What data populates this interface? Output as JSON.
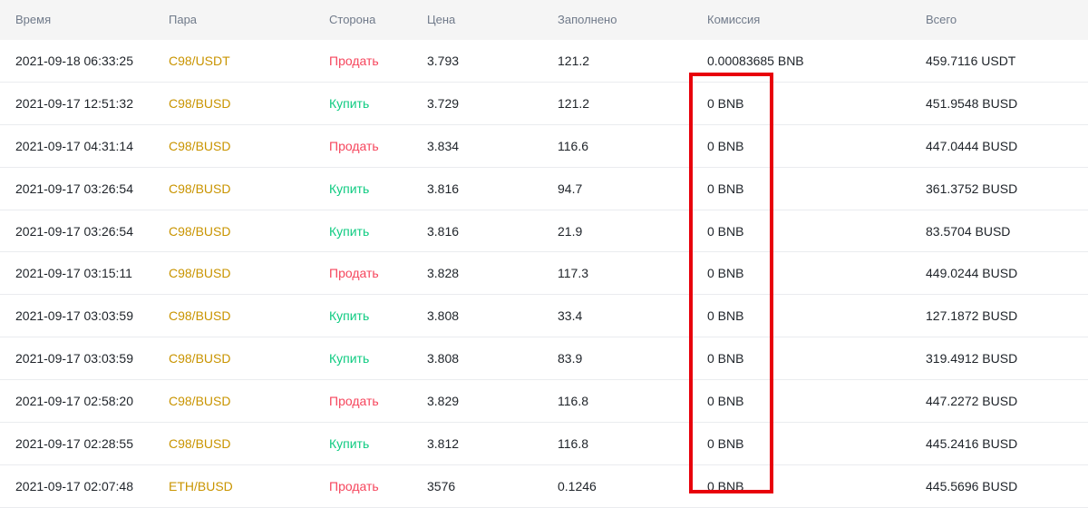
{
  "headers": {
    "time": "Время",
    "pair": "Пара",
    "side": "Сторона",
    "price": "Цена",
    "filled": "Заполнено",
    "fee": "Комиссия",
    "total": "Всего"
  },
  "rows": [
    {
      "time": "2021-09-18 06:33:25",
      "pair": "C98/USDT",
      "side": "Продать",
      "price": "3.793",
      "filled": "121.2",
      "fee": "0.00083685 BNB",
      "total": "459.7116 USDT"
    },
    {
      "time": "2021-09-17 12:51:32",
      "pair": "C98/BUSD",
      "side": "Купить",
      "price": "3.729",
      "filled": "121.2",
      "fee": "0 BNB",
      "total": "451.9548 BUSD"
    },
    {
      "time": "2021-09-17 04:31:14",
      "pair": "C98/BUSD",
      "side": "Продать",
      "price": "3.834",
      "filled": "116.6",
      "fee": "0 BNB",
      "total": "447.0444 BUSD"
    },
    {
      "time": "2021-09-17 03:26:54",
      "pair": "C98/BUSD",
      "side": "Купить",
      "price": "3.816",
      "filled": "94.7",
      "fee": "0 BNB",
      "total": "361.3752 BUSD"
    },
    {
      "time": "2021-09-17 03:26:54",
      "pair": "C98/BUSD",
      "side": "Купить",
      "price": "3.816",
      "filled": "21.9",
      "fee": "0 BNB",
      "total": "83.5704 BUSD"
    },
    {
      "time": "2021-09-17 03:15:11",
      "pair": "C98/BUSD",
      "side": "Продать",
      "price": "3.828",
      "filled": "117.3",
      "fee": "0 BNB",
      "total": "449.0244 BUSD"
    },
    {
      "time": "2021-09-17 03:03:59",
      "pair": "C98/BUSD",
      "side": "Купить",
      "price": "3.808",
      "filled": "33.4",
      "fee": "0 BNB",
      "total": "127.1872 BUSD"
    },
    {
      "time": "2021-09-17 03:03:59",
      "pair": "C98/BUSD",
      "side": "Купить",
      "price": "3.808",
      "filled": "83.9",
      "fee": "0 BNB",
      "total": "319.4912 BUSD"
    },
    {
      "time": "2021-09-17 02:58:20",
      "pair": "C98/BUSD",
      "side": "Продать",
      "price": "3.829",
      "filled": "116.8",
      "fee": "0 BNB",
      "total": "447.2272 BUSD"
    },
    {
      "time": "2021-09-17 02:28:55",
      "pair": "C98/BUSD",
      "side": "Купить",
      "price": "3.812",
      "filled": "116.8",
      "fee": "0 BNB",
      "total": "445.2416 BUSD"
    },
    {
      "time": "2021-09-17 02:07:48",
      "pair": "ETH/BUSD",
      "side": "Продать",
      "price": "3576",
      "filled": "0.1246",
      "fee": "0 BNB",
      "total": "445.5696 BUSD"
    }
  ],
  "colors": {
    "pair": "#c99400",
    "buy": "#0ecb81",
    "sell": "#f6465d",
    "highlight": "#e8000b"
  }
}
